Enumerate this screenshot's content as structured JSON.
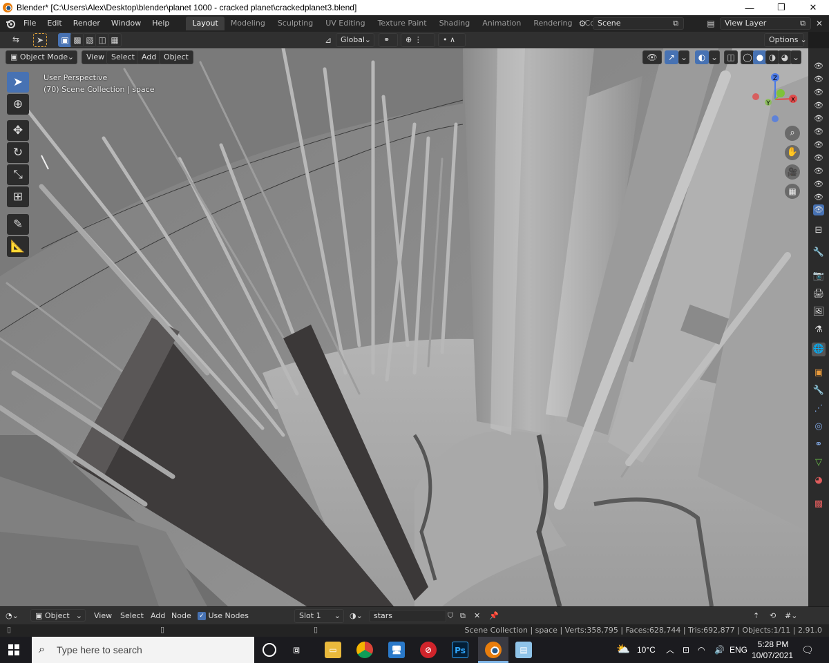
{
  "window": {
    "title": "Blender* [C:\\Users\\Alex\\Desktop\\blender\\planet 1000 - cracked planet\\crackedplanet3.blend]",
    "minimize": "—",
    "restore": "❐",
    "close": "✕"
  },
  "menus": [
    "File",
    "Edit",
    "Render",
    "Window",
    "Help"
  ],
  "workspaces": [
    "Layout",
    "Modeling",
    "Sculpting",
    "UV Editing",
    "Texture Paint",
    "Shading",
    "Animation",
    "Rendering",
    "Compositing"
  ],
  "active_workspace": "Layout",
  "scene": {
    "name": "Scene",
    "view_layer": "View Layer"
  },
  "tool_settings": {
    "orientation": "Global",
    "options": "Options"
  },
  "viewport_header": {
    "mode": "Object Mode",
    "menus": [
      "View",
      "Select",
      "Add",
      "Object"
    ]
  },
  "viewport_info": {
    "line1": "User Perspective",
    "line2": "(70) Scene Collection | space"
  },
  "gizmo": {
    "z": "Z",
    "y": "Y",
    "x": "X"
  },
  "shader_header": {
    "editor": "Object",
    "menus": [
      "View",
      "Select",
      "Add",
      "Node"
    ],
    "use_nodes": "Use Nodes",
    "slot": "Slot 1",
    "material": "stars"
  },
  "status": {
    "text": "Scene Collection | space | Verts:358,795 | Faces:628,744 | Tris:692,877 | Objects:1/11 | 2.91.0"
  },
  "taskbar": {
    "search_placeholder": "Type here to search",
    "temperature": "10°C",
    "language": "ENG",
    "time": "5:28 PM",
    "date": "10/07/2021",
    "apps": [
      "file-explorer",
      "chrome",
      "remote-desktop",
      "antivirus",
      "photoshop",
      "blender",
      "notes"
    ],
    "ps_label": "Ps"
  },
  "colors": {
    "accent": "#4772b3",
    "axis_x": "#e14b4b",
    "axis_y": "#7ec23a",
    "axis_z": "#4d7be6"
  }
}
